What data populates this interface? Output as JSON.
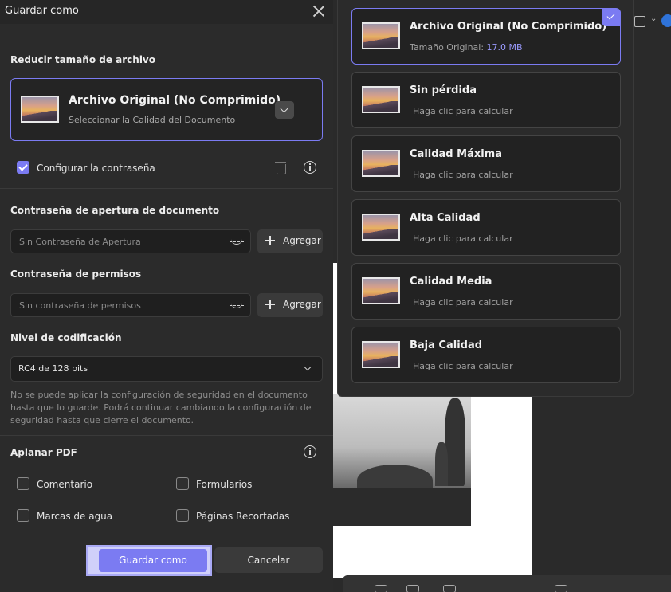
{
  "dialog": {
    "title": "Guardar como",
    "reduce": {
      "label": "Reducir tamaño de archivo",
      "selected_title": "Archivo Original (No Comprimido)",
      "selected_subtitle": "Seleccionar la Calidad del Documento"
    },
    "password_toggle": {
      "label": "Configurar la contraseña",
      "checked": true
    },
    "open_password": {
      "label": "Contraseña de apertura de documento",
      "placeholder": "Sin Contraseña de Apertura",
      "add_label": "Agregar"
    },
    "permission_password": {
      "label": "Contraseña de permisos",
      "placeholder": "Sin contraseña de permisos",
      "add_label": "Agregar"
    },
    "encryption": {
      "label": "Nivel de codificación",
      "value": "RC4 de 128 bits"
    },
    "note": "No se puede aplicar la configuración de seguridad en el documento hasta que lo guarde. Podrá continuar cambiando la configuración de seguridad hasta que cierre el documento.",
    "flatten": {
      "label": "Aplanar PDF",
      "options": [
        {
          "label": "Comentario",
          "checked": false
        },
        {
          "label": "Formularios",
          "checked": false
        },
        {
          "label": "Marcas de agua",
          "checked": false
        },
        {
          "label": "Páginas Recortadas",
          "checked": false
        }
      ]
    },
    "buttons": {
      "save": "Guardar como",
      "cancel": "Cancelar"
    }
  },
  "quality_menu": {
    "options": [
      {
        "title": "Archivo Original (No Comprimido)",
        "subtitle_prefix": "Tamaño Original: ",
        "size": "17.0 MB",
        "selected": true
      },
      {
        "title": "Sin pérdida",
        "subtitle": "Haga clic para calcular",
        "selected": false
      },
      {
        "title": "Calidad Máxima",
        "subtitle": "Haga clic para calcular",
        "selected": false
      },
      {
        "title": "Alta Calidad",
        "subtitle": "Haga clic para calcular",
        "selected": false
      },
      {
        "title": "Calidad Media",
        "subtitle": "Haga clic para calcular",
        "selected": false
      },
      {
        "title": "Baja Calidad",
        "subtitle": "Haga clic para calcular",
        "selected": false
      }
    ]
  },
  "colors": {
    "accent": "#7b7bf2",
    "size_text": "#9b9bff",
    "panel": "#2b2b2b"
  },
  "icons": [
    "close-icon",
    "chevron-down-icon",
    "trash-icon",
    "info-icon",
    "eye-icon",
    "plus-icon",
    "check-icon"
  ]
}
